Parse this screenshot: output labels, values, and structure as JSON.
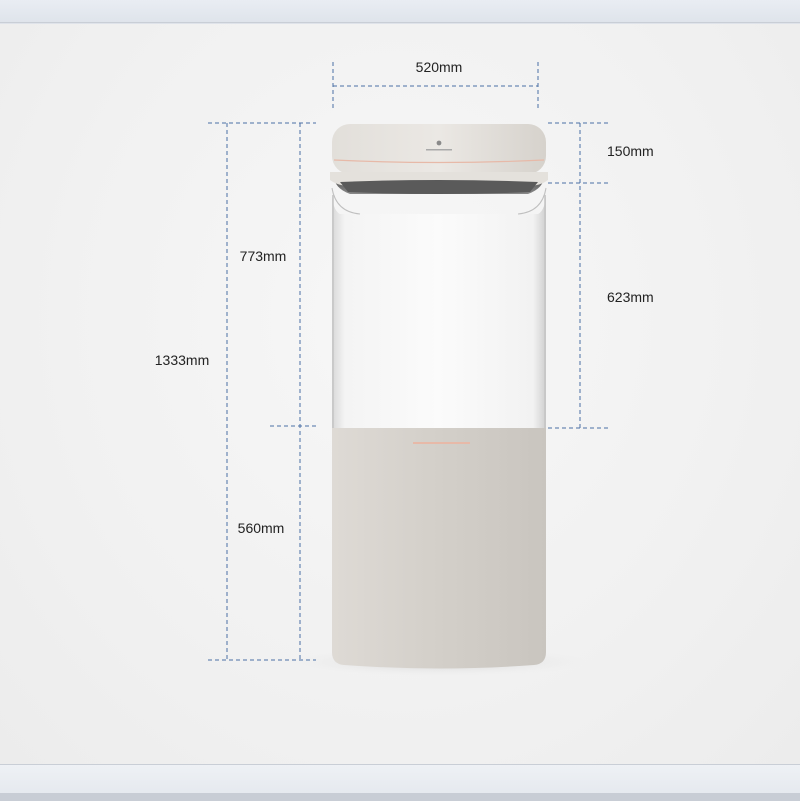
{
  "dimensions": {
    "width_top": "520mm",
    "head_height": "150mm",
    "tank_height": "623mm",
    "upper_height": "773mm",
    "total_height": "1333mm",
    "base_height": "560mm"
  },
  "colors": {
    "dimension_line": "#4a6fa5",
    "body": "#dcd8d2",
    "accent_line": "#e7b9a8"
  }
}
